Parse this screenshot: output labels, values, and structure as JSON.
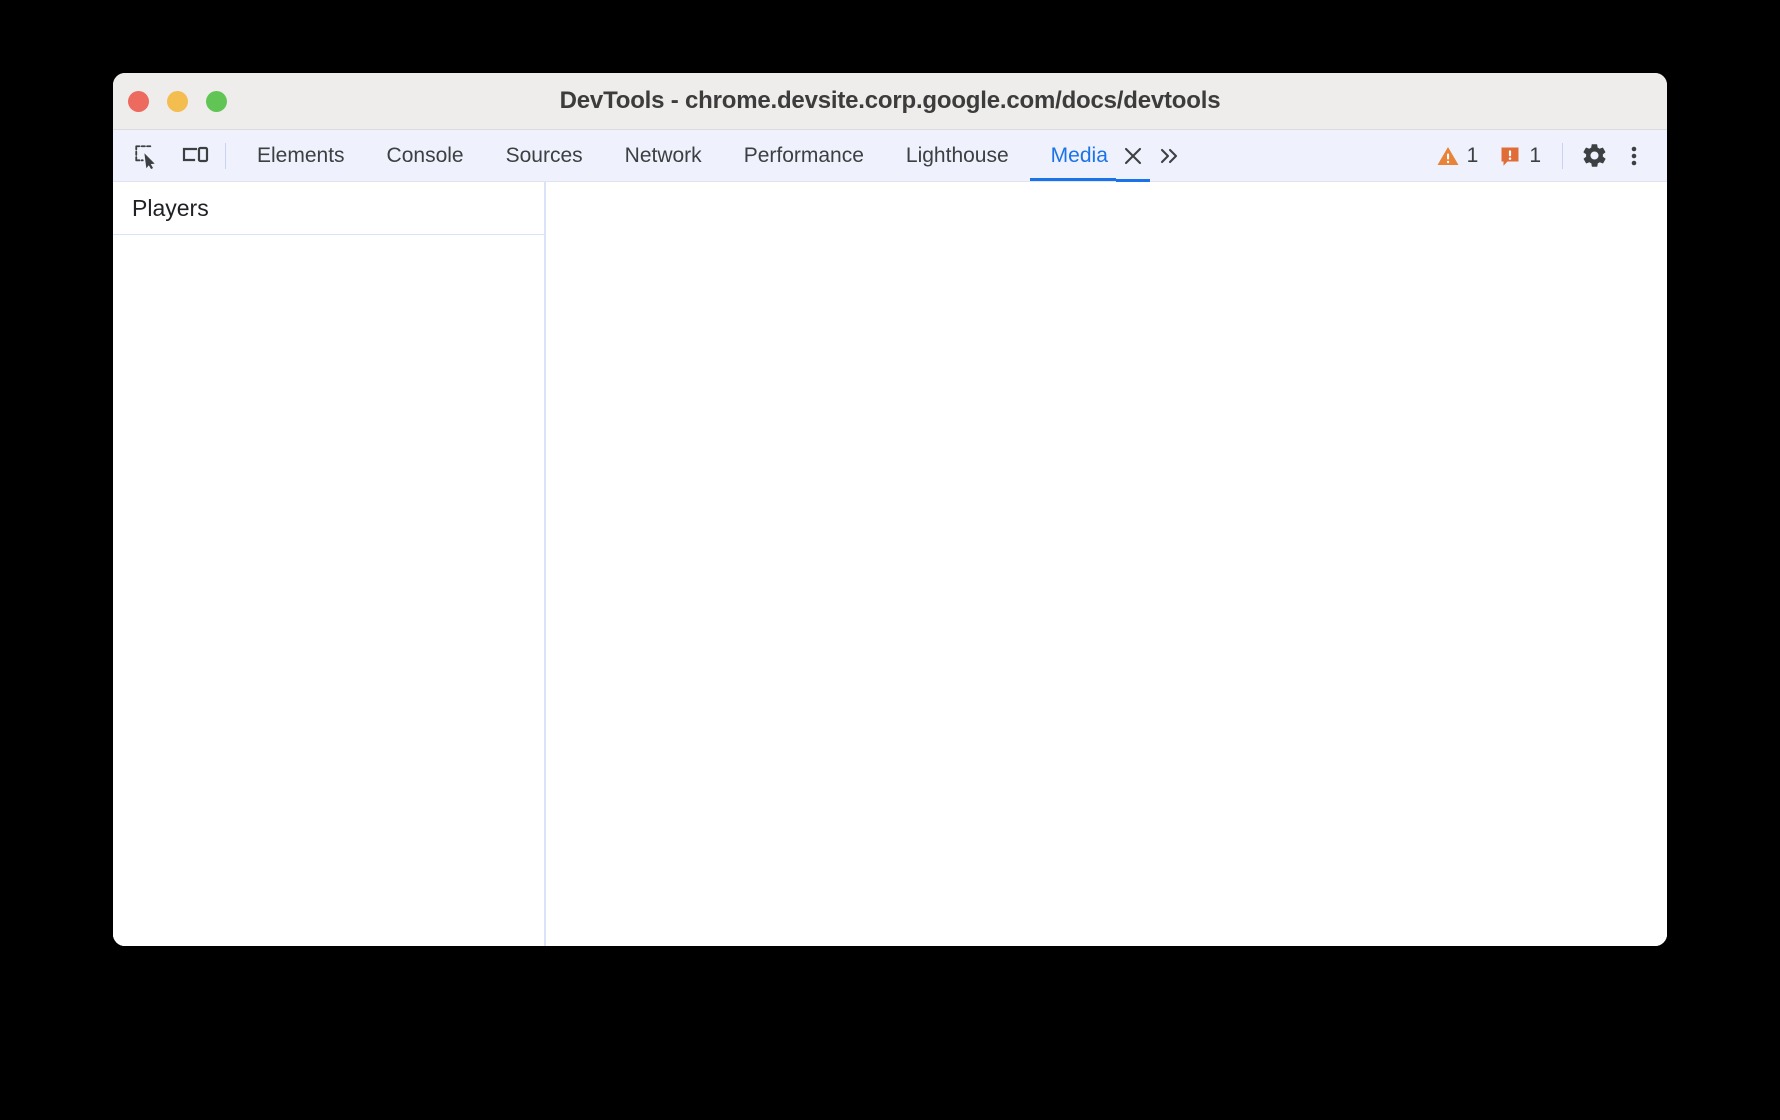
{
  "window": {
    "title": "DevTools - chrome.devsite.corp.google.com/docs/devtools",
    "traffic_lights": [
      {
        "name": "close",
        "color": "#ec6a5e"
      },
      {
        "name": "minimize",
        "color": "#f4bd4f"
      },
      {
        "name": "maximize",
        "color": "#61c555"
      }
    ]
  },
  "toolbar": {
    "inspect_icon": "inspect-element-icon",
    "device_icon": "device-toolbar-icon",
    "tabs": [
      {
        "label": "Elements",
        "active": false
      },
      {
        "label": "Console",
        "active": false
      },
      {
        "label": "Sources",
        "active": false
      },
      {
        "label": "Network",
        "active": false
      },
      {
        "label": "Performance",
        "active": false
      },
      {
        "label": "Lighthouse",
        "active": false
      },
      {
        "label": "Media",
        "active": true
      }
    ],
    "close_tab_icon": "close-icon",
    "overflow_icon": "double-chevron-right-icon",
    "warnings": {
      "icon": "warning-triangle-icon",
      "count": "1",
      "color": "#e8833a"
    },
    "issues": {
      "icon": "issue-bubble-icon",
      "count": "1",
      "color": "#e06c38"
    },
    "settings_icon": "gear-icon",
    "more_icon": "more-vertical-icon",
    "accent_color": "#1a73e8"
  },
  "media_panel": {
    "sidebar_title": "Players",
    "players": [],
    "detail_content": ""
  }
}
